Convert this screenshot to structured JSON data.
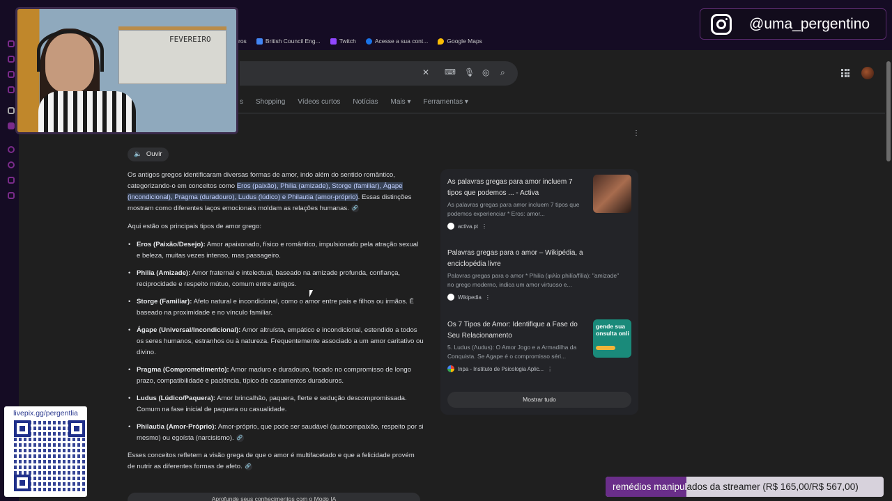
{
  "bookmarks": [
    {
      "label": "ros",
      "color": "#8ab4f8"
    },
    {
      "label": "British Council Eng...",
      "color": "#4285f4"
    },
    {
      "label": "Twitch",
      "color": "#9146ff"
    },
    {
      "label": "Acesse a sua cont...",
      "color": "#1a73e8"
    },
    {
      "label": "Google Maps",
      "color": "#fbbc04"
    }
  ],
  "search": {
    "tabs": [
      "s",
      "Shopping",
      "Vídeos curtos",
      "Notícias",
      "Mais ▾",
      "Ferramentas ▾"
    ]
  },
  "webcam": {
    "board_text": "FEVEREIRO"
  },
  "instagram": {
    "handle": "@uma_pergentino"
  },
  "overview": {
    "listen_label": "Ouvir",
    "intro_a": "Os antigos gregos identificaram diversas formas de amor, indo além do sentido romântico, categorizando-o em conceitos como ",
    "intro_hl": "Eros (paixão), Philia (amizade), Storge (familiar), Ágape (incondicional), Pragma (duradouro), Ludus (lúdico) e Philautia (amor-próprio)",
    "intro_b": ". Essas distinções mostram como diferentes laços emocionais moldam as relações humanas.",
    "list_intro": "Aqui estão os principais tipos de amor grego:",
    "types": [
      {
        "name": "Eros (Paixão/Desejo):",
        "desc": " Amor apaixonado, físico e romântico, impulsionado pela atração sexual e beleza, muitas vezes intenso, mas passageiro."
      },
      {
        "name": "Philia (Amizade):",
        "desc": " Amor fraternal e intelectual, baseado na amizade profunda, confiança, reciprocidade e respeito mútuo, comum entre amigos."
      },
      {
        "name": "Storge (Familiar):",
        "desc": " Afeto natural e incondicional, como o amor entre pais e filhos ou irmãos. É baseado na proximidade e no vínculo familiar."
      },
      {
        "name": "Ágape (Universal/Incondicional):",
        "desc": " Amor altruísta, empático e incondicional, estendido a todos os seres humanos, estranhos ou à natureza. Frequentemente associado a um amor caritativo ou divino."
      },
      {
        "name": "Pragma (Comprometimento):",
        "desc": " Amor maduro e duradouro, focado no compromisso de longo prazo, compatibilidade e paciência, típico de casamentos duradouros."
      },
      {
        "name": "Ludus (Lúdico/Paquera):",
        "desc": " Amor brincalhão, paquera, flerte e sedução descompromissada. Comum na fase inicial de paquera ou casualidade."
      },
      {
        "name": "Philautia (Amor-Próprio):",
        "desc": " Amor-próprio, que pode ser saudável (autocompaixão, respeito por si mesmo) ou egoísta (narcisismo)."
      }
    ],
    "conclusion": "Esses conceitos refletem a visão grega de que o amor é multifacetado e que a felicidade provém de nutrir as diferentes formas de afeto.",
    "more_label": "Aprofunde seus conhecimentos com o Modo IA"
  },
  "sources": [
    {
      "title": "As palavras gregas para amor incluem 7 tipos que podemos ... - Activa",
      "snippet": "As palavras gregas para amor incluem 7 tipos que podemos experienciar * Eros: amor...",
      "site": "activa.pt",
      "site_color": "#ffffff"
    },
    {
      "title": "Palavras gregas para o amor – Wikipédia, a enciclopédia livre",
      "snippet": "Palavras gregas para o amor * Philia (φιλία philía/fília): \"amizade\" no grego moderno, indica um amor virtuoso e...",
      "site": "Wikipedia",
      "site_color": "#ffffff"
    },
    {
      "title": "Os 7 Tipos de Amor: Identifique a Fase do Seu Relacionamento",
      "snippet": "5. Ludus (Λudus): O Amor Jogo e a Armadilha da Conquista. Se Agape é o compromisso séri...",
      "site": "Inpa - Instituto de Psicologia Aplic...",
      "site_color": "#ea4335",
      "thumb_text": "gende sua onsulta onli"
    }
  ],
  "show_all_label": "Mostrar tudo",
  "donation": {
    "label": "livepix.gg/pergentlia"
  },
  "goal": {
    "text": "remédios manipulados da streamer (R$ 165,00/R$ 567,00)",
    "current": 165,
    "target": 567,
    "fill_color": "#6a2e8a"
  }
}
